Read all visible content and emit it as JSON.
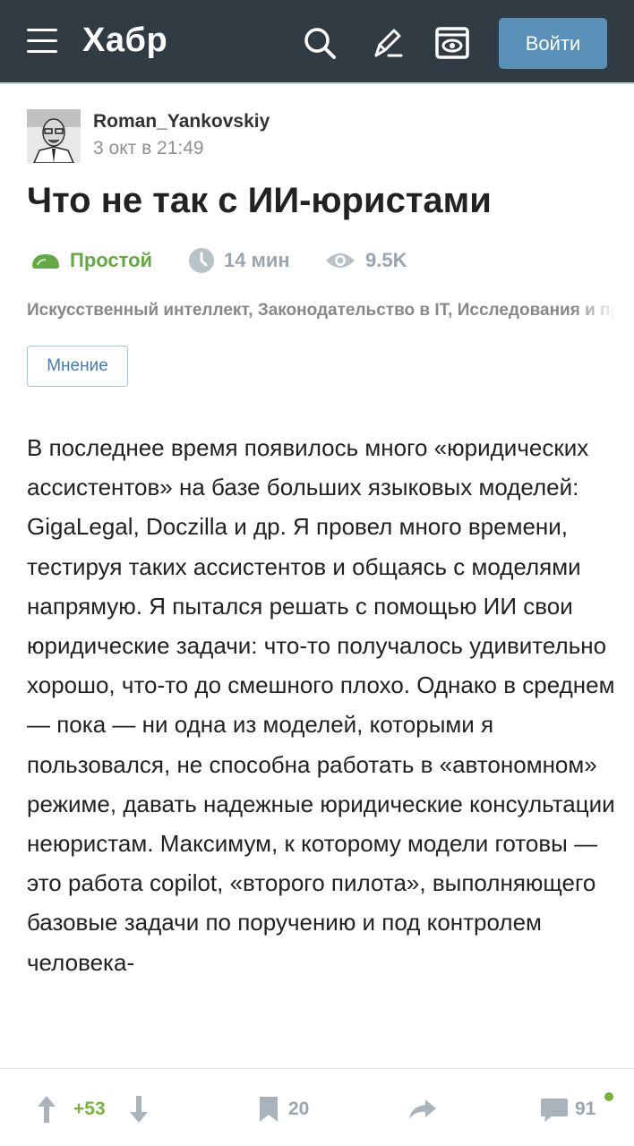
{
  "header": {
    "logo": "Хабр",
    "login_label": "Войти"
  },
  "article": {
    "author": "Roman_Yankovskiy",
    "date": "3 окт в 21:49",
    "title": "Что не так с ИИ-юристами",
    "complexity": "Простой",
    "reading_time": "14 мин",
    "views": "9.5K",
    "hubs": "Искусственный интеллект, Законодательство в IT, Исследования и прогнозы в IT",
    "tag": "Мнение",
    "body": "В последнее время появилось много «юридических ассистентов» на базе больших языковых моделей: GigaLegal, Doczilla и др. Я провел много времени, тестируя таких ассистентов и общаясь с моделями напрямую. Я пытался решать с помощью ИИ свои юридические задачи: что-то получалось удивительно хорошо, что-то до смешного плохо. Однако в среднем — пока — ни одна из моделей, которыми я пользовался, не способна работать в «автономном» режиме, давать надежные юридические консультации неюристам. Максимум, к которому модели готовы — это работа copilot, «второго пилота», выполняющего базовые задачи по поручению и под контролем человека-"
  },
  "bottom_bar": {
    "votes": "+53",
    "bookmarks": "20",
    "comments": "91"
  },
  "colors": {
    "header_bg": "#303b44",
    "login_bg": "#5a8fb8",
    "green": "#7bb13f",
    "icon_gray": "#9aa5ad"
  },
  "icons": [
    "menu-icon",
    "search-icon",
    "write-icon",
    "reader-mode-icon",
    "complexity-icon",
    "clock-icon",
    "eye-icon",
    "arrow-up-icon",
    "arrow-down-icon",
    "bookmark-icon",
    "share-icon",
    "comment-icon"
  ]
}
